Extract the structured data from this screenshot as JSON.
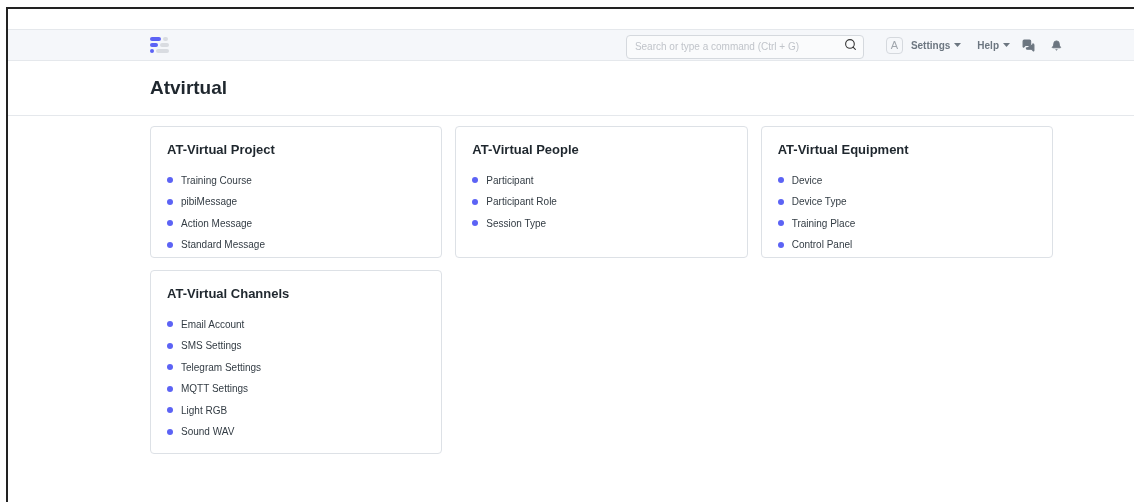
{
  "navbar": {
    "search": {
      "placeholder": "Search or type a command (Ctrl + G)"
    },
    "avatar": "A",
    "menus": [
      "Settings",
      "Help"
    ]
  },
  "page_title": "Atvirtual",
  "cards": [
    {
      "title": "AT-Virtual Project",
      "links": [
        "Training Course",
        "pibiMessage",
        "Action Message",
        "Standard Message"
      ]
    },
    {
      "title": "AT-Virtual People",
      "links": [
        "Participant",
        "Participant Role",
        "Session Type"
      ]
    },
    {
      "title": "AT-Virtual Equipment",
      "links": [
        "Device",
        "Device Type",
        "Training Place",
        "Control Panel"
      ]
    },
    {
      "title": "AT-Virtual Channels",
      "links": [
        "Email Account",
        "SMS Settings",
        "Telegram Settings",
        "MQTT Settings",
        "Light RGB",
        "Sound WAV"
      ]
    }
  ]
}
